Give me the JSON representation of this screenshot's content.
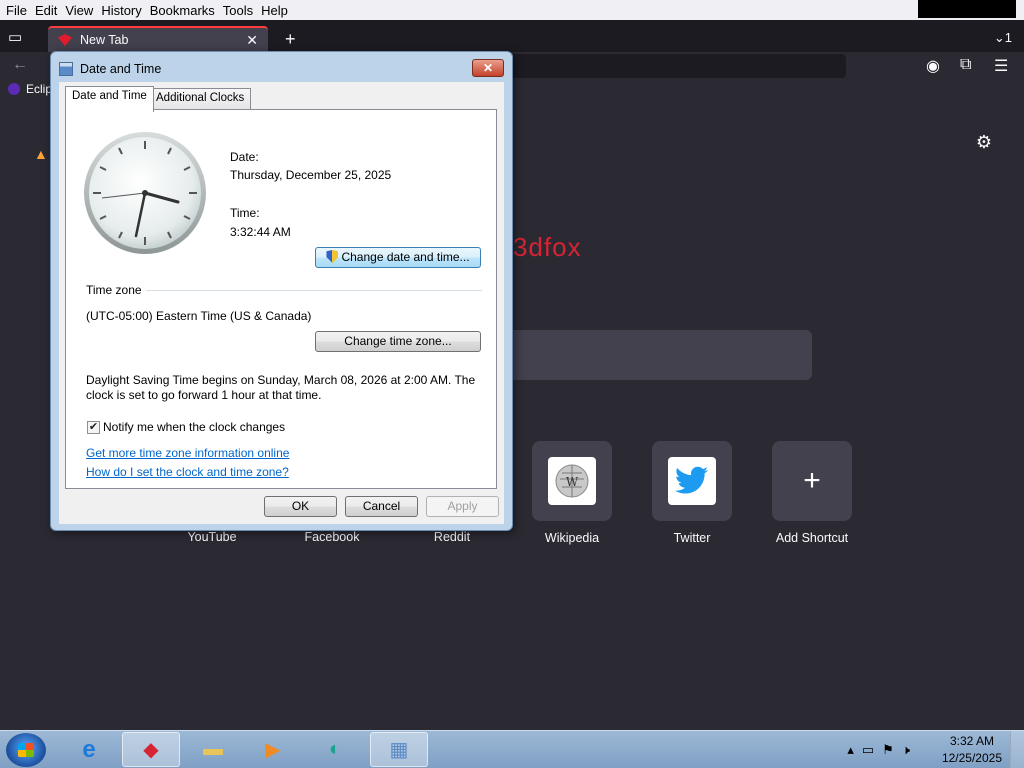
{
  "menubar": {
    "items": [
      {
        "label": "File"
      },
      {
        "label": "Edit"
      },
      {
        "label": "View"
      },
      {
        "label": "History"
      },
      {
        "label": "Bookmarks"
      },
      {
        "label": "Tools"
      },
      {
        "label": "Help"
      }
    ]
  },
  "browser": {
    "tab_title": "New Tab",
    "bookmark_label": "Eclip",
    "brand_text": "3dfox",
    "shortcuts": [
      {
        "label": "YouTube",
        "icon": "youtube-icon"
      },
      {
        "label": "Facebook",
        "icon": "facebook-icon"
      },
      {
        "label": "Reddit",
        "icon": "reddit-icon"
      },
      {
        "label": "Wikipedia",
        "icon": "wikipedia-icon"
      },
      {
        "label": "Twitter",
        "icon": "twitter-icon"
      },
      {
        "label": "Add Shortcut",
        "icon": "plus-icon"
      }
    ]
  },
  "dialog": {
    "title": "Date and Time",
    "close_label": "✕",
    "tabs": [
      {
        "label": "Date and Time",
        "active": true
      },
      {
        "label": "Additional Clocks",
        "active": false
      }
    ],
    "date_label": "Date:",
    "date_value": "Thursday, December 25, 2025",
    "time_label": "Time:",
    "time_value": "3:32:44 AM",
    "change_datetime_button": "Change date and time...",
    "timezone_heading": "Time zone",
    "timezone_value": "(UTC-05:00) Eastern Time (US & Canada)",
    "change_timezone_button": "Change time zone...",
    "dst_line1": "Daylight Saving Time begins on Sunday, March 08, 2026 at 2:00 AM. The",
    "dst_line2": "clock is set to go forward 1 hour at that time.",
    "notify_label": "Notify me when the clock changes",
    "notify_checked": true,
    "link1": "Get more time zone information online",
    "link2": "How do I set the clock and time zone?",
    "ok_button": "OK",
    "cancel_button": "Cancel",
    "apply_button": "Apply"
  },
  "taskbar": {
    "clock_time": "3:32 AM",
    "clock_date": "12/25/2025"
  },
  "colors": {
    "accent_red": "#d72434",
    "link_blue": "#0066cc",
    "page_bg": "#2b2a33"
  }
}
